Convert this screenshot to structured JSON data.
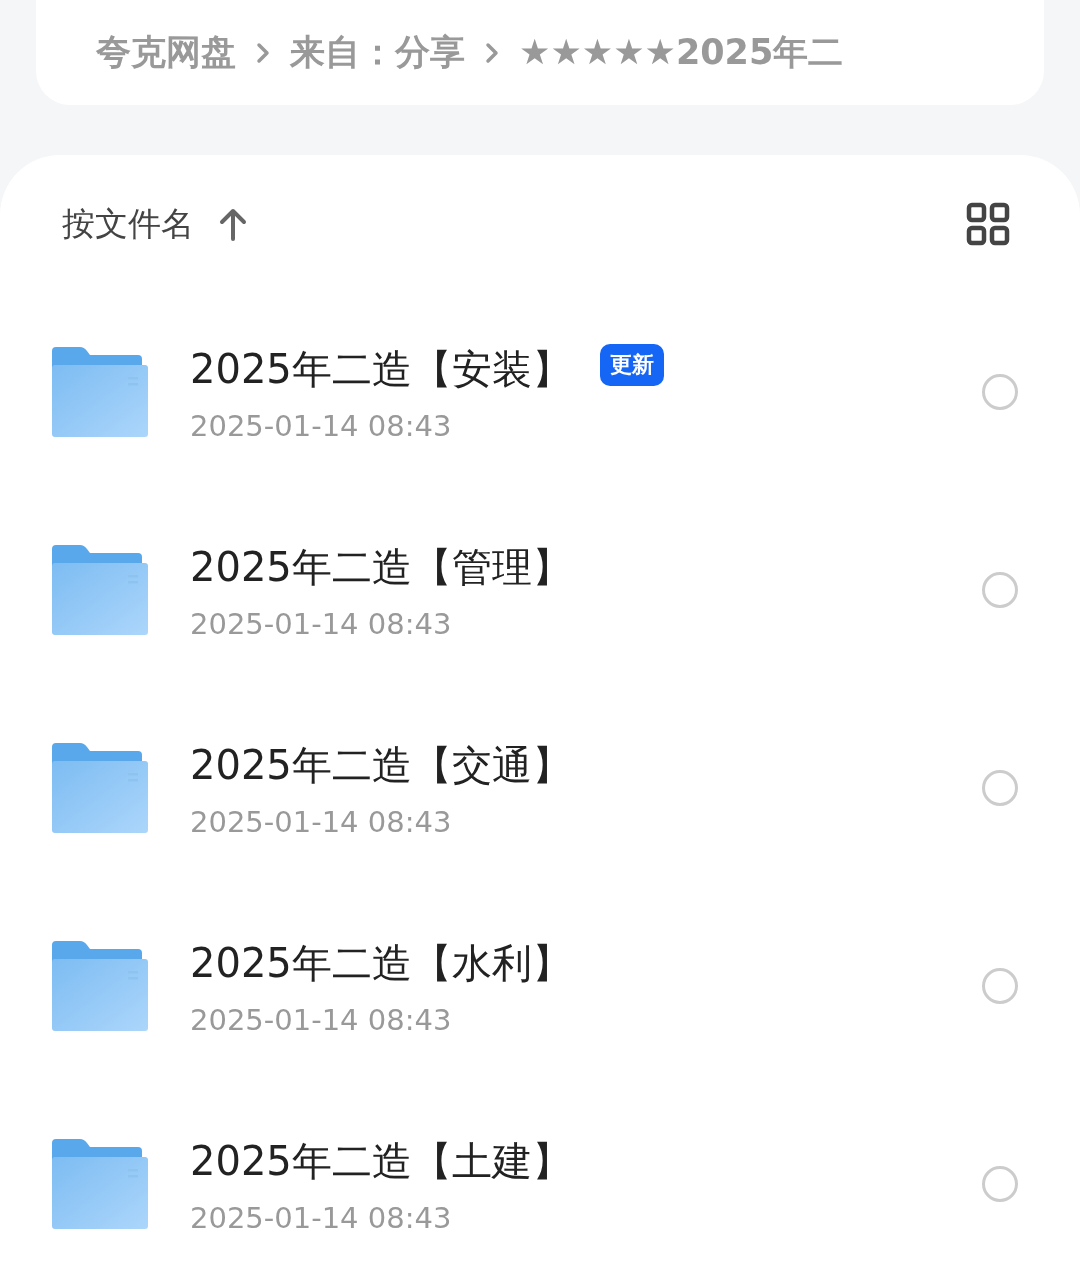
{
  "breadcrumb": [
    "夸克网盘",
    "来自：分享",
    "★★★★★2025年二"
  ],
  "sort": {
    "label": "按文件名"
  },
  "files": [
    {
      "name": "2025年二造【安装】",
      "badge": "更新",
      "date": "2025-01-14 08:43",
      "selected": false
    },
    {
      "name": "2025年二造【管理】",
      "date": "2025-01-14 08:43",
      "selected": false
    },
    {
      "name": "2025年二造【交通】",
      "date": "2025-01-14 08:43",
      "selected": false
    },
    {
      "name": "2025年二造【水利】",
      "date": "2025-01-14 08:43",
      "selected": false
    },
    {
      "name": "2025年二造【土建】",
      "date": "2025-01-14 08:43",
      "selected": false
    }
  ]
}
